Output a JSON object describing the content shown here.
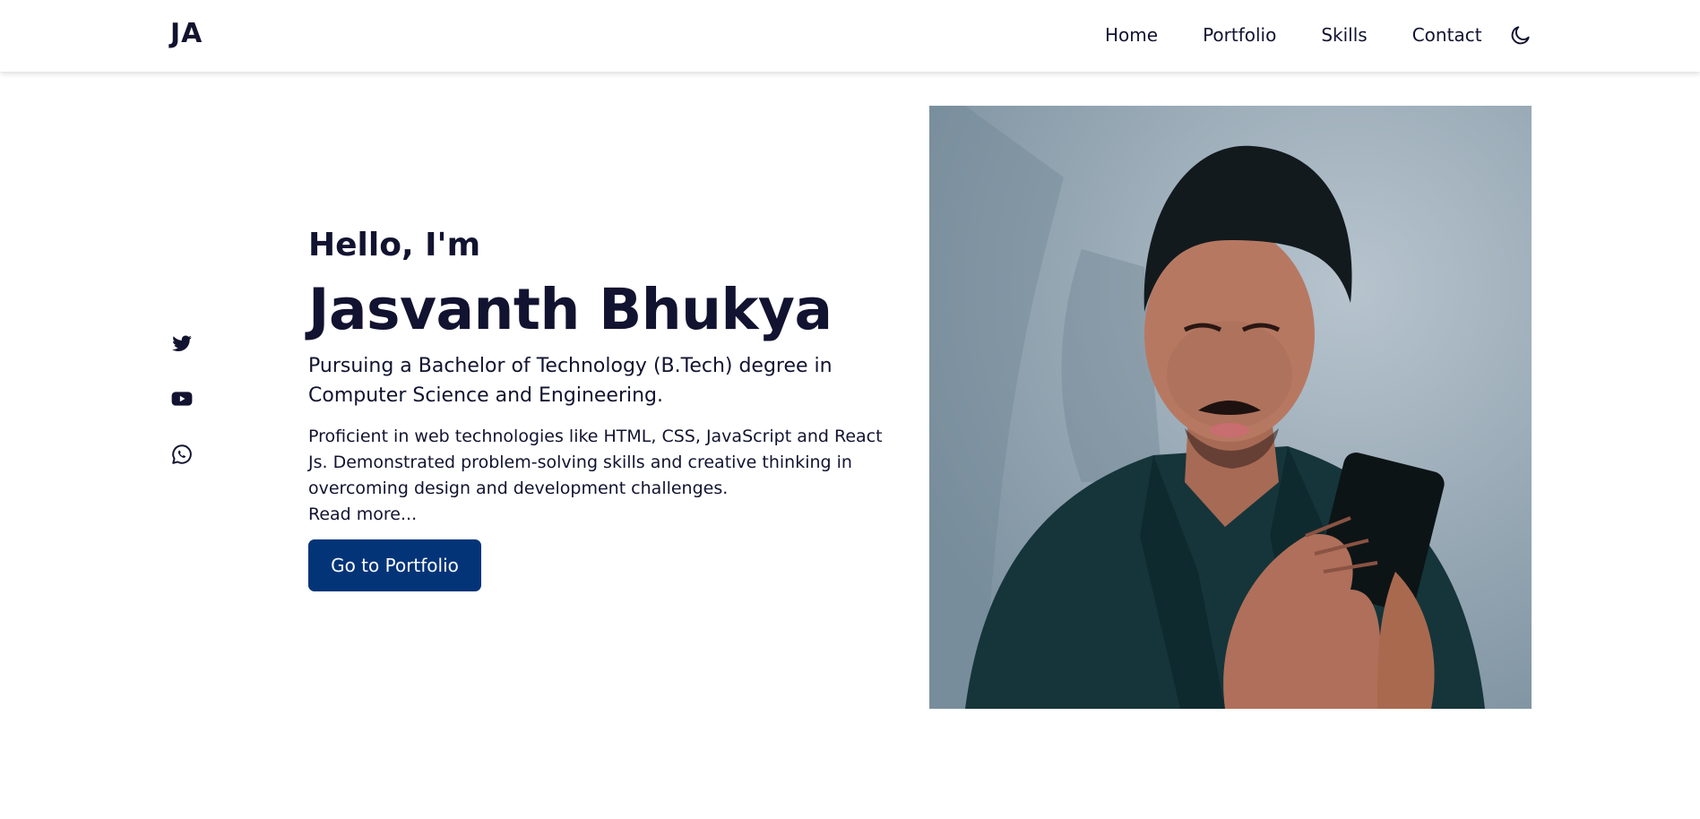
{
  "header": {
    "logo": "JA",
    "nav": [
      "Home",
      "Portfolio",
      "Skills",
      "Contact"
    ],
    "theme_toggle_icon": "moon-icon"
  },
  "social": {
    "icons": [
      "twitter-icon",
      "youtube-icon",
      "whatsapp-icon"
    ]
  },
  "hero": {
    "greeting": "Hello, I'm",
    "name": "Jasvanth Bhukya",
    "degree": "Pursuing a Bachelor of Technology (B.Tech) degree in Computer Science and Engineering.",
    "description": "Proficient in web technologies like HTML, CSS, JavaScript and React Js. Demonstrated problem-solving skills and creative thinking in overcoming design and development challenges.",
    "read_more": "Read more...",
    "cta_label": "Go to Portfolio"
  },
  "colors": {
    "text": "#121330",
    "accent": "#043478"
  }
}
